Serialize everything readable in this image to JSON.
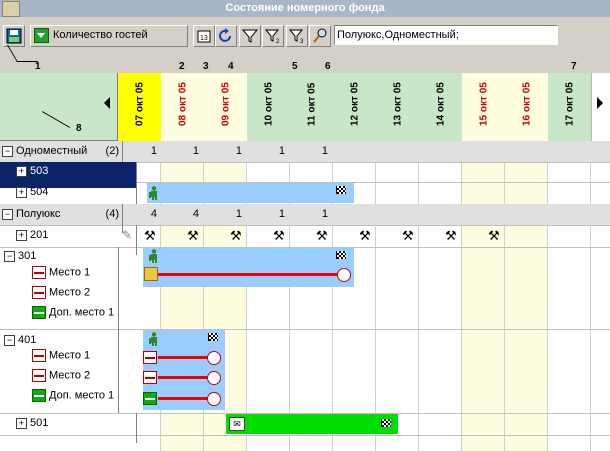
{
  "window": {
    "title": "Состояние номерного фонда"
  },
  "toolbar": {
    "dropdown_label": "Количество гостей",
    "filter_text": "Полуюкс,Одноместный;",
    "callouts": [
      "1",
      "2",
      "3",
      "4",
      "5",
      "6",
      "7",
      "8"
    ]
  },
  "dates": [
    {
      "label": "07 окт 05",
      "color": "#000000"
    },
    {
      "label": "08 окт 05",
      "color": "#cc0000"
    },
    {
      "label": "09 окт 05",
      "color": "#cc0000"
    },
    {
      "label": "10 окт 05",
      "color": "#000000"
    },
    {
      "label": "11 окт 05",
      "color": "#000000"
    },
    {
      "label": "12 окт 05",
      "color": "#000000"
    },
    {
      "label": "13 окт 05",
      "color": "#000000"
    },
    {
      "label": "14 окт 05",
      "color": "#000000"
    },
    {
      "label": "15 окт 05",
      "color": "#cc0000"
    },
    {
      "label": "16 окт 05",
      "color": "#cc0000"
    },
    {
      "label": "17 окт 05",
      "color": "#000000"
    }
  ],
  "rows": {
    "single": {
      "label": "Одноместный",
      "count": "(2)",
      "values": [
        "1",
        "1",
        "1",
        "1",
        "1"
      ]
    },
    "r503": {
      "label": "503"
    },
    "r504": {
      "label": "504"
    },
    "junior": {
      "label": "Полуюкс",
      "count": "(4)",
      "values": [
        "4",
        "4",
        "1",
        "1",
        "1"
      ]
    },
    "r201": {
      "label": "201"
    },
    "r301": {
      "label": "301",
      "beds": [
        "Место 1",
        "Место 2",
        "Доп. место 1"
      ]
    },
    "r401": {
      "label": "401",
      "beds": [
        "Место 1",
        "Место 2",
        "Доп. место 1"
      ]
    },
    "r501": {
      "label": "501"
    }
  },
  "colors": {
    "today": "#ffff00",
    "weekend_bg": "#fffde0",
    "header_green": "#c8e6c8",
    "bar_blue": "#99ccff",
    "bar_green": "#00dd00",
    "group_bg": "#e0e0e0"
  }
}
